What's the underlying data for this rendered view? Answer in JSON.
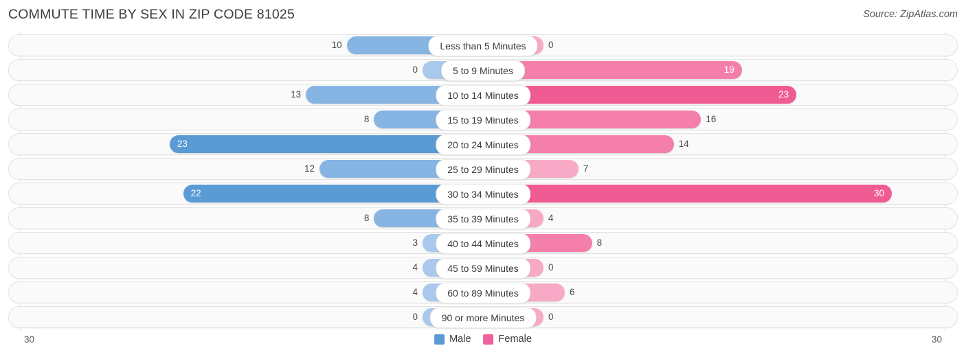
{
  "header": {
    "title": "COMMUTE TIME BY SEX IN ZIP CODE 81025",
    "source": "Source: ZipAtlas.com"
  },
  "axis": {
    "left_tick": "30",
    "right_tick": "30",
    "max": 30
  },
  "legend": {
    "items": [
      {
        "label": "Male",
        "color": "#5b9bd5"
      },
      {
        "label": "Female",
        "color": "#f0609a"
      }
    ]
  },
  "colors": {
    "male_dark": "#5b9bd5",
    "male_mid": "#86b5e3",
    "male_light": "#a9c9ec",
    "female_dark": "#ef5b92",
    "female_mid": "#f57fab",
    "female_light": "#f7a9c6"
  },
  "chart_data": {
    "type": "bar",
    "title": "COMMUTE TIME BY SEX IN ZIP CODE 81025",
    "subtitle": "",
    "xlabel": "",
    "ylabel": "",
    "orientation": "horizontal-diverging",
    "grid": false,
    "legend_position": "bottom-center",
    "xlim": [
      30,
      30
    ],
    "categories": [
      "Less than 5 Minutes",
      "5 to 9 Minutes",
      "10 to 14 Minutes",
      "15 to 19 Minutes",
      "20 to 24 Minutes",
      "25 to 29 Minutes",
      "30 to 34 Minutes",
      "35 to 39 Minutes",
      "40 to 44 Minutes",
      "45 to 59 Minutes",
      "60 to 89 Minutes",
      "90 or more Minutes"
    ],
    "series": [
      {
        "name": "Male",
        "values": [
          10,
          0,
          13,
          8,
          23,
          12,
          22,
          8,
          3,
          4,
          4,
          0
        ]
      },
      {
        "name": "Female",
        "values": [
          0,
          19,
          23,
          16,
          14,
          7,
          30,
          4,
          8,
          0,
          6,
          0
        ]
      }
    ]
  }
}
